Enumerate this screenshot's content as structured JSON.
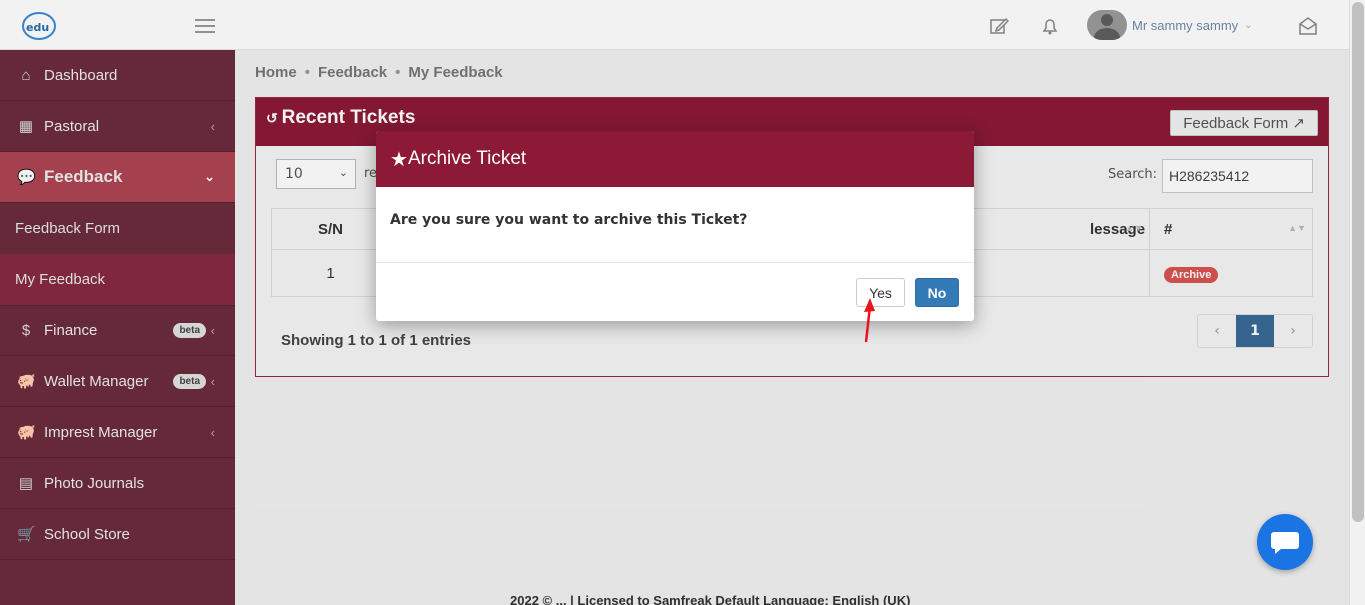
{
  "topbar": {
    "user_name": "Mr sammy sammy"
  },
  "sidebar": {
    "items": [
      {
        "label": "Dashboard"
      },
      {
        "label": "Pastoral"
      },
      {
        "label": "Feedback"
      },
      {
        "label": "Feedback Form"
      },
      {
        "label": "My Feedback"
      },
      {
        "label": "Finance",
        "badge": "beta"
      },
      {
        "label": "Wallet Manager",
        "badge": "beta"
      },
      {
        "label": "Imprest Manager"
      },
      {
        "label": "Photo Journals"
      },
      {
        "label": "School Store"
      }
    ]
  },
  "breadcrumb": [
    "Home",
    "Feedback",
    "My Feedback"
  ],
  "panel": {
    "title": "Recent Tickets",
    "feedback_form_button": "Feedback Form",
    "page_length": "10",
    "length_suffix": "re",
    "search_label": "Search:",
    "search_value": "H286235412",
    "columns": [
      "S/N",
      "lessage",
      "#"
    ],
    "rows": [
      {
        "sn": "1",
        "action": "Archive"
      }
    ],
    "info": "Showing 1 to 1 of 1 entries",
    "pager": {
      "prev": "‹",
      "current": "1",
      "next": "›"
    }
  },
  "modal": {
    "title": "Archive Ticket",
    "message": "Are you sure you want to archive this Ticket?",
    "yes_label": "Yes",
    "no_label": "No"
  },
  "footer": {
    "text": "2022 © ... | Licensed to Samfreak   Default Language: English (UK)"
  },
  "colors": {
    "sidebar": "#6b2c3e",
    "active": "#ae4553",
    "header": "#8c1a36",
    "primary": "#337ab7"
  }
}
